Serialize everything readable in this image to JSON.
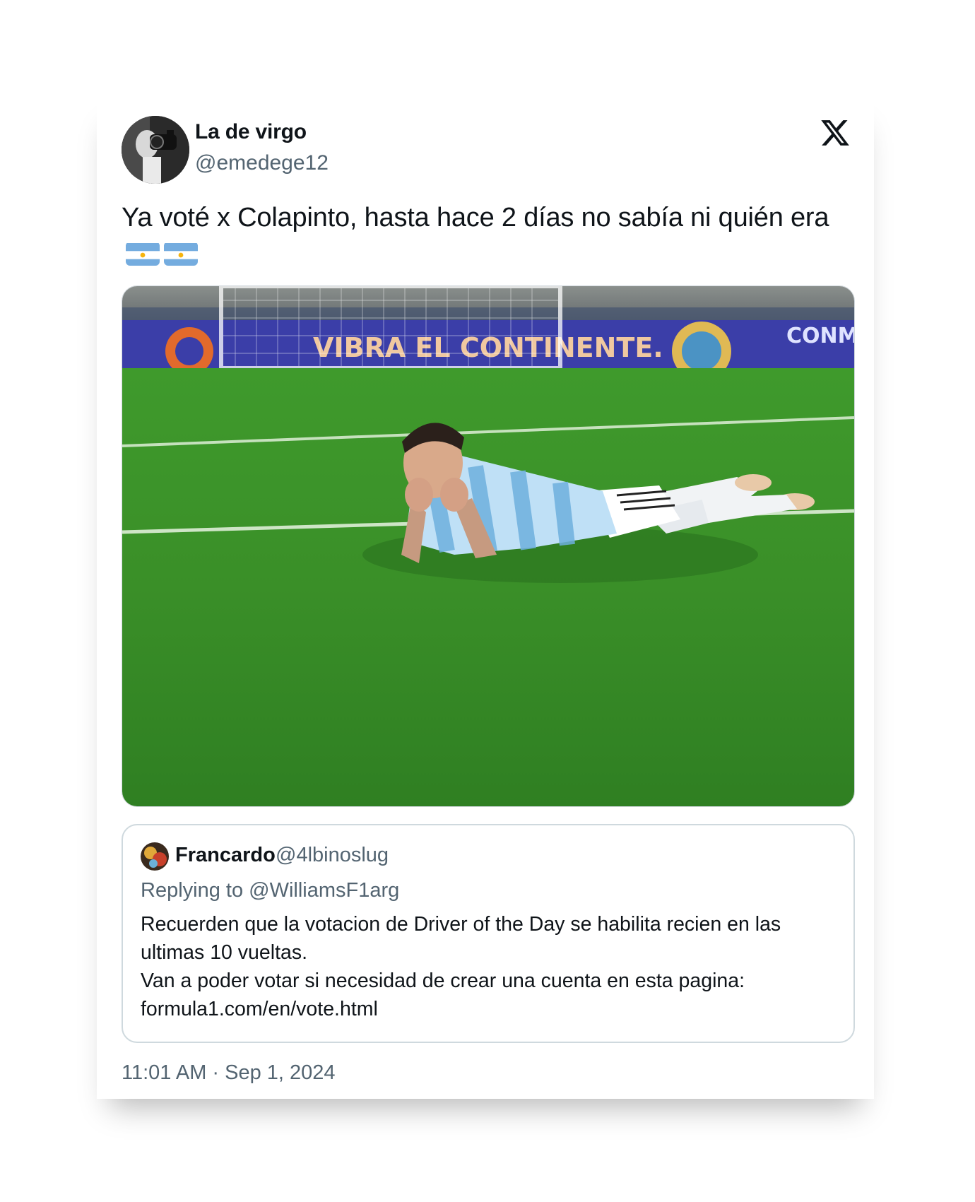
{
  "tweet": {
    "author": {
      "display_name": "La de virgo",
      "handle": "@emedege12",
      "avatar_icon": "profile-photo"
    },
    "platform_icon": "x-logo-icon",
    "text": "Ya voté x Colapinto, hasta hace 2 días no sabía ni quién era",
    "emoji": [
      "argentina-flag-icon",
      "argentina-flag-icon"
    ],
    "media": {
      "banner_text": "VIBRA EL CONTINENTE.",
      "banner_text_right": "CONM"
    },
    "quoted": {
      "display_name": "Francardo",
      "handle": "@4lbinoslug",
      "reply_prefix": "Replying to @WilliamsF1arg",
      "text": "Recuerden que la votacion de Driver of the Day se habilita recien en las ultimas 10 vueltas.\nVan a poder votar si necesidad de crear una cuenta en esta pagina:\nformula1.com/en/vote.html"
    },
    "timestamp": "11:01 AM · Sep 1, 2024"
  },
  "colors": {
    "text_primary": "#0f1419",
    "text_secondary": "#536471",
    "border": "#cfd9de",
    "flag_blue": "#74acdf",
    "flag_sun": "#f6b40e"
  }
}
